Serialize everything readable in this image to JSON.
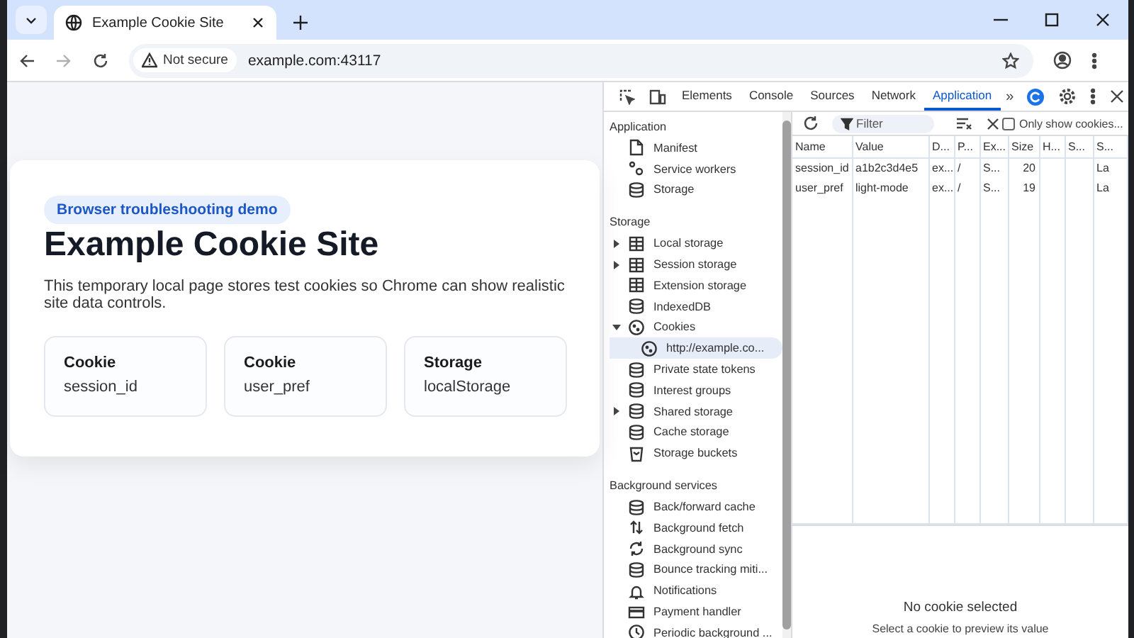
{
  "browser": {
    "tab": {
      "title": "Example Cookie Site",
      "selected": true
    },
    "security_chip": "Not secure",
    "url": "example.com:43117"
  },
  "page": {
    "badge": "Browser troubleshooting demo",
    "title": "Example Cookie Site",
    "description": "This temporary local page stores test cookies so Chrome can show realistic site data controls.",
    "cards": [
      {
        "label": "Cookie",
        "value": "session_id"
      },
      {
        "label": "Cookie",
        "value": "user_pref"
      },
      {
        "label": "Storage",
        "value": "localStorage"
      }
    ]
  },
  "devtools": {
    "tabs": [
      {
        "label": "Elements",
        "selected": false
      },
      {
        "label": "Console",
        "selected": false
      },
      {
        "label": "Sources",
        "selected": false
      },
      {
        "label": "Network",
        "selected": false
      },
      {
        "label": "Application",
        "selected": true
      }
    ],
    "more_tabs": "»",
    "sidebar": [
      {
        "heading": "Application",
        "items": [
          {
            "label": "Manifest",
            "kind": "file",
            "selected": false
          },
          {
            "label": "Service workers",
            "kind": "gear",
            "selected": false
          },
          {
            "label": "Storage",
            "kind": "database",
            "selected": false
          }
        ]
      },
      {
        "heading": "Storage",
        "items": [
          {
            "label": "Local storage",
            "kind": "table",
            "expanded": false,
            "selected": false
          },
          {
            "label": "Session storage",
            "kind": "table",
            "expanded": false,
            "selected": false
          },
          {
            "label": "Extension storage",
            "kind": "table",
            "selected": false
          },
          {
            "label": "IndexedDB",
            "kind": "database",
            "selected": false
          },
          {
            "label": "Cookies",
            "kind": "cookie",
            "expanded": true,
            "selected": false,
            "children": [
              {
                "label": "http://example.co...",
                "kind": "cookie",
                "selected": true
              }
            ]
          },
          {
            "label": "Private state tokens",
            "kind": "database",
            "selected": false
          },
          {
            "label": "Interest groups",
            "kind": "database",
            "selected": false
          },
          {
            "label": "Shared storage",
            "kind": "database",
            "expanded": false,
            "selected": false
          },
          {
            "label": "Cache storage",
            "kind": "database",
            "selected": false
          },
          {
            "label": "Storage buckets",
            "kind": "bucket",
            "selected": false
          }
        ]
      },
      {
        "heading": "Background services",
        "items": [
          {
            "label": "Back/forward cache",
            "kind": "database",
            "selected": false
          },
          {
            "label": "Background fetch",
            "kind": "arrows",
            "selected": false
          },
          {
            "label": "Background sync",
            "kind": "sync",
            "selected": false
          },
          {
            "label": "Bounce tracking miti...",
            "kind": "database",
            "selected": false
          },
          {
            "label": "Notifications",
            "kind": "bell",
            "selected": false
          },
          {
            "label": "Payment handler",
            "kind": "card",
            "selected": false
          },
          {
            "label": "Periodic background ...",
            "kind": "clock",
            "selected": false
          }
        ]
      }
    ],
    "filter": {
      "placeholder": "Filter"
    },
    "only_show_cookies": {
      "label": "Only show cookies...",
      "checked": false
    },
    "table": {
      "columns": [
        "Name",
        "Value",
        "D...",
        "P...",
        "Ex...",
        "Size",
        "H...",
        "S...",
        "S..."
      ],
      "rows": [
        {
          "cells": [
            "session_id",
            "a1b2c3d4e5",
            "ex...",
            "/",
            "S...",
            "20",
            null,
            null,
            "La"
          ]
        },
        {
          "cells": [
            "user_pref",
            "light-mode",
            "ex...",
            "/",
            "S...",
            "19",
            null,
            null,
            "La"
          ]
        }
      ]
    },
    "preview": {
      "title": "No cookie selected",
      "hint": "Select a cookie to preview its value"
    }
  }
}
